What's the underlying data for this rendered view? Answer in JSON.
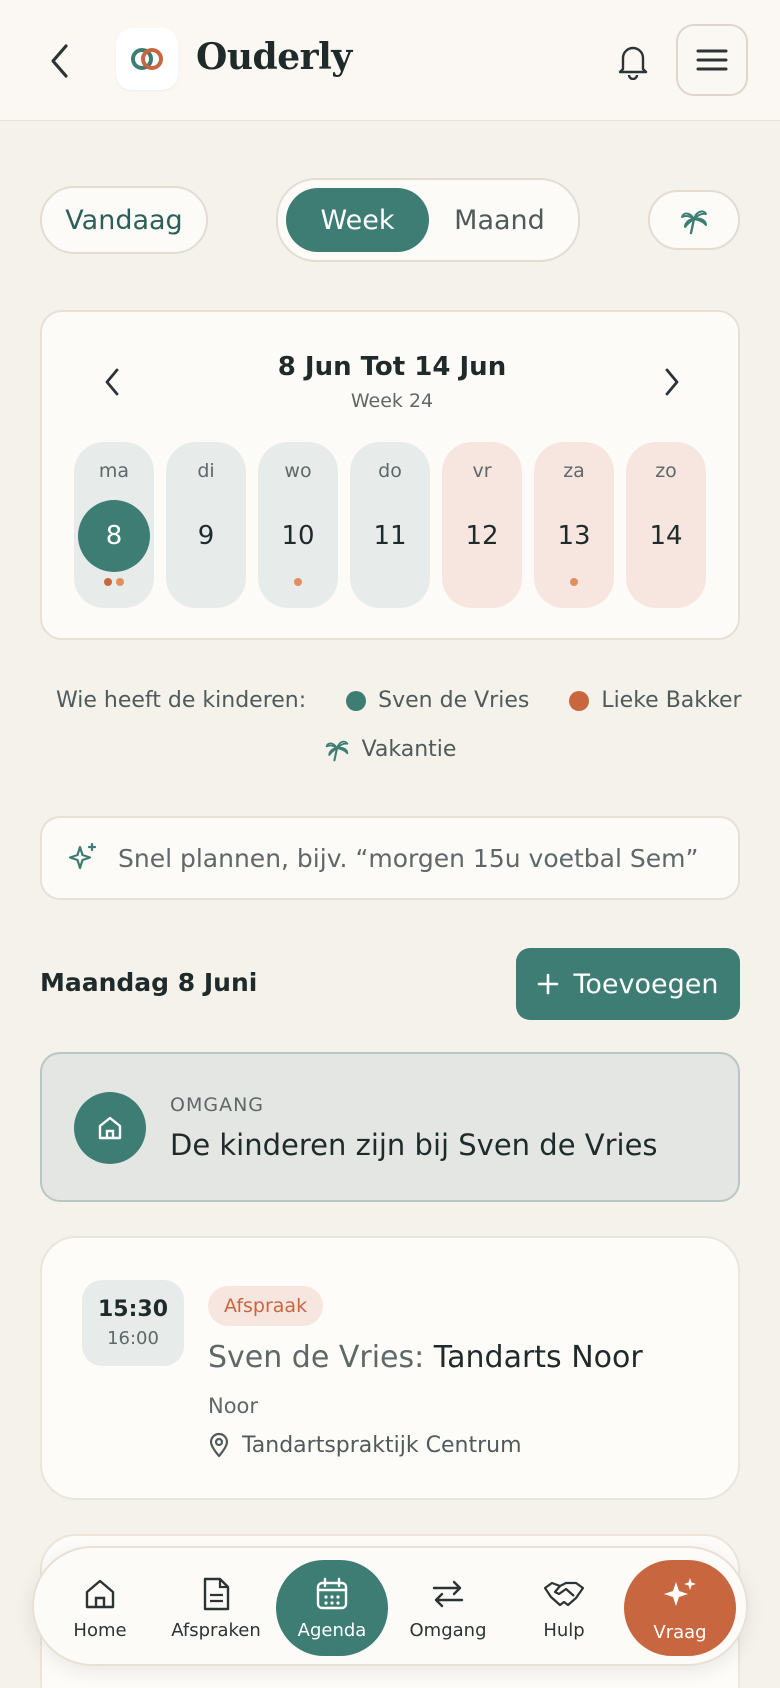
{
  "header": {
    "brand": "Ouderly"
  },
  "toggles": {
    "today": "Vandaag",
    "week": "Week",
    "month": "Maand"
  },
  "calendar": {
    "range": "8 Jun Tot 14 Jun",
    "week_label": "Week 24",
    "days": [
      {
        "wd": "ma",
        "num": "8"
      },
      {
        "wd": "di",
        "num": "9"
      },
      {
        "wd": "wo",
        "num": "10"
      },
      {
        "wd": "do",
        "num": "11"
      },
      {
        "wd": "vr",
        "num": "12"
      },
      {
        "wd": "za",
        "num": "13"
      },
      {
        "wd": "zo",
        "num": "14"
      }
    ]
  },
  "legend": {
    "label": "Wie heeft de kinderen:",
    "parent_a": "Sven de Vries",
    "parent_b": "Lieke Bakker",
    "vacation": "Vakantie",
    "color_a": "#3d7d74",
    "color_b": "#c8673f"
  },
  "quick_plan": {
    "placeholder": "Snel plannen, bijv. “morgen 15u voetbal Sem”"
  },
  "day_section": {
    "title": "Maandag 8 Juni",
    "add_label": "Toevoegen"
  },
  "omgang": {
    "eyebrow": "OMGANG",
    "text": "De kinderen zijn bij Sven de Vries"
  },
  "appointment": {
    "start": "15:30",
    "end": "16:00",
    "badge": "Afspraak",
    "who": "Sven de Vries:",
    "what": "Tandarts Noor",
    "child": "Noor",
    "location": "Tandartspraktijk Centrum"
  },
  "nav": {
    "home": "Home",
    "afspraken": "Afspraken",
    "agenda": "Agenda",
    "omgang": "Omgang",
    "hulp": "Hulp",
    "vraag": "Vraag"
  }
}
